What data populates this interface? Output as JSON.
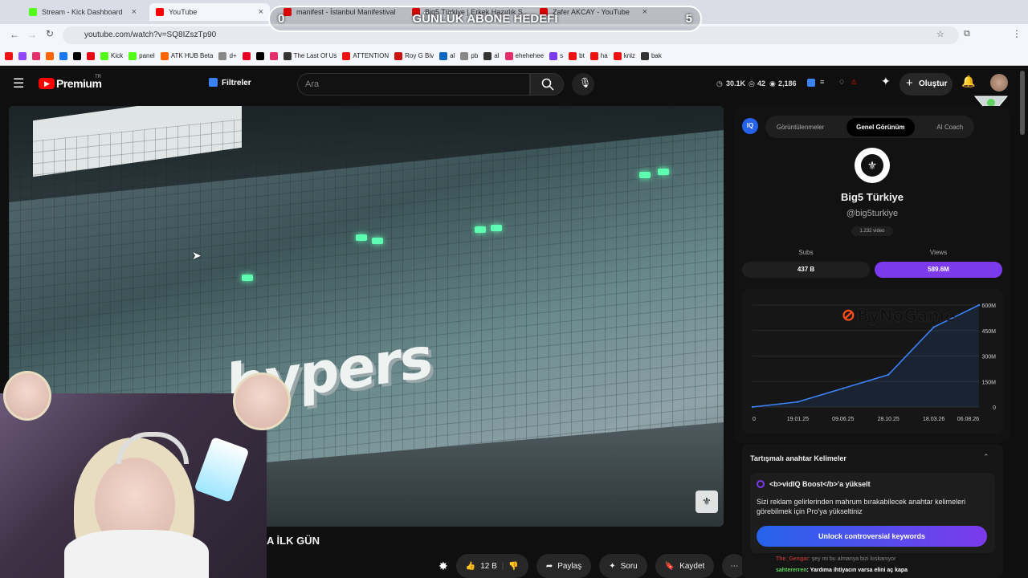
{
  "browser": {
    "tabs": [
      {
        "label": "Stream - Kick Dashboard",
        "color": "#53fc18"
      },
      {
        "label": "YouTube",
        "color": "#ff0000"
      },
      {
        "label": "manifest - İstanbul Manifestival",
        "color": "#ff0000"
      },
      {
        "label": "Big5 Türkiye | Erkek Hazırlık S...",
        "color": "#ff0000"
      },
      {
        "label": "Zafer AKCAY - YouTube",
        "color": "#ff0000"
      }
    ],
    "url": "youtube.com/watch?v=SQ8IZszTp90",
    "bookmarks": [
      "Kick",
      "panel",
      "ATK HUB Beta",
      "d+",
      "The Last Of Us",
      "ATTENTION",
      "Roy G Biv",
      "al",
      "pb",
      "al",
      "ehehehee",
      "s",
      "bt",
      "ha",
      "knlz",
      "bak"
    ]
  },
  "overlay": {
    "title": "GÜNLÜK ABONE HEDEFİ",
    "current": "0",
    "target": "5"
  },
  "youtube": {
    "logo_text": "Premium",
    "logo_region": "TR",
    "filters_label": "Filtreler",
    "search_placeholder": "Ara",
    "header_stats": {
      "views": "30.1K",
      "count": "42",
      "watching": "2,186"
    },
    "create_label": "Oluştur"
  },
  "video": {
    "scene_text": "hypers",
    "title": "A İLK GÜN"
  },
  "actions": {
    "likes": "12 B",
    "share": "Paylaş",
    "ask": "Soru",
    "save": "Kaydet"
  },
  "vidiq": {
    "tabs": [
      "Görüntülenmeler",
      "Genel Görünüm",
      "AI Coach"
    ],
    "channel_name": "Big5 Türkiye",
    "channel_handle": "@big5turkiye",
    "video_count": "1.232 video",
    "subs_label": "Subs",
    "views_label": "Views",
    "subs_value": "437 B",
    "views_value": "589.6M",
    "watermark": "ByNoGame",
    "keywords_title": "Tartışmalı anahtar Kelimeler",
    "boost_title": "<b>vidIQ Boost</b>'a yükselt",
    "boost_text": "Sizi reklam gelirlerinden mahrum bırakabilecek anahtar kelimeleri görebilmek için Pro'ya yükseltiniz",
    "unlock_label": "Unlock controversial keywords"
  },
  "chat": [
    {
      "user": "The_Gengar",
      "msg": ": şey mi bu almanya bizi kıskanıyor"
    },
    {
      "user": "sahtererren",
      "msg": ": Yardıma ihtiyacın varsa elini aç kapa"
    }
  ],
  "chart_data": {
    "type": "area",
    "x": [
      "0",
      "19.01.25",
      "09.06.25",
      "28.10.25",
      "18.03.26",
      "06.08.26"
    ],
    "values": [
      0,
      30,
      110,
      190,
      470,
      600
    ],
    "ylabel": "",
    "xlabel": "",
    "yticks": [
      "0",
      "150M",
      "300M",
      "450M",
      "600M"
    ],
    "ylim": [
      0,
      600
    ],
    "color": "#3b82f6"
  }
}
